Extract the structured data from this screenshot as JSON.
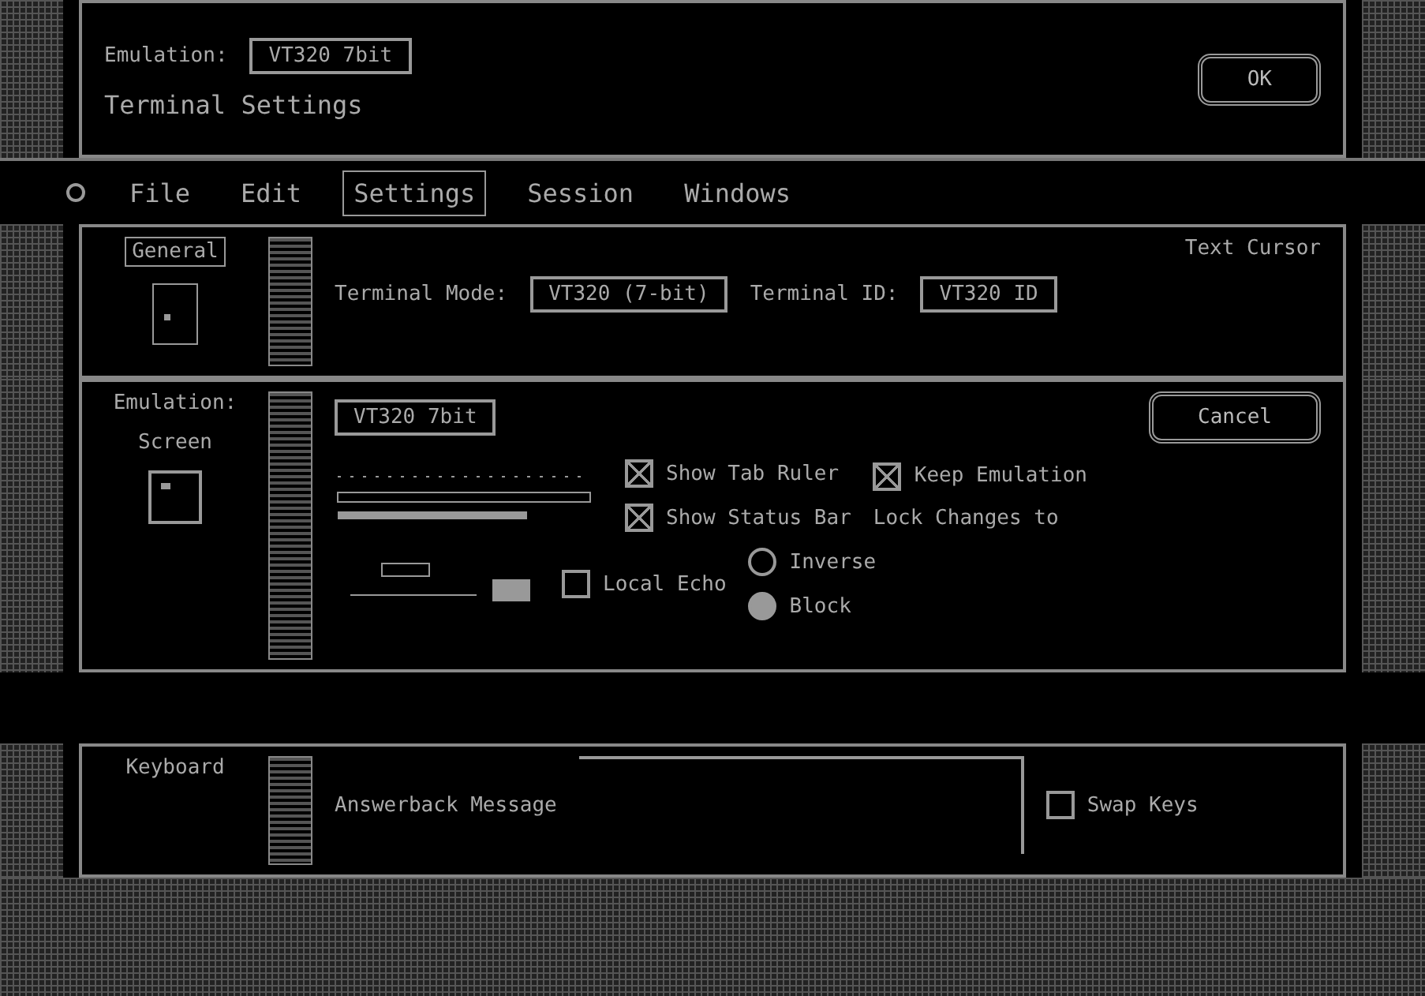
{
  "top_dialog": {
    "emulation_label": "Emulation:",
    "emulation_value": "VT320 7bit",
    "title": "Terminal Settings",
    "ok_button": "OK"
  },
  "menu_bar": {
    "items": [
      {
        "label": "File",
        "selected": false
      },
      {
        "label": "Edit",
        "selected": false
      },
      {
        "label": "Settings",
        "selected": true
      },
      {
        "label": "Session",
        "selected": false
      },
      {
        "label": "Windows",
        "selected": false
      }
    ]
  },
  "general_panel": {
    "category": "General",
    "text_cursor_label": "Text Cursor",
    "terminal_mode_label": "Terminal Mode:",
    "terminal_mode_value": "VT320 (7-bit)",
    "terminal_id_label": "Terminal ID:",
    "terminal_id_value": "VT320 ID"
  },
  "screen_panel": {
    "emulation_label": "Emulation:",
    "emulation_value": "VT320 7bit",
    "category": "Screen",
    "cancel_button": "Cancel",
    "options": [
      {
        "label": "Show Tab Ruler",
        "checked": true
      },
      {
        "label": "Show Status Bar",
        "checked": true
      },
      {
        "label": "Local Echo",
        "checked": false
      }
    ],
    "keep_label": "Keep Emulation",
    "keep_checked": true,
    "lock_label": "Lock Changes to",
    "cursor_styles": [
      {
        "label": "Inverse",
        "selected": false
      },
      {
        "label": "Block",
        "selected": true
      }
    ]
  },
  "keyboard_panel": {
    "category": "Keyboard",
    "answerback_label": "Answerback Message",
    "swap_label": "Swap Keys",
    "swap_checked": false
  }
}
